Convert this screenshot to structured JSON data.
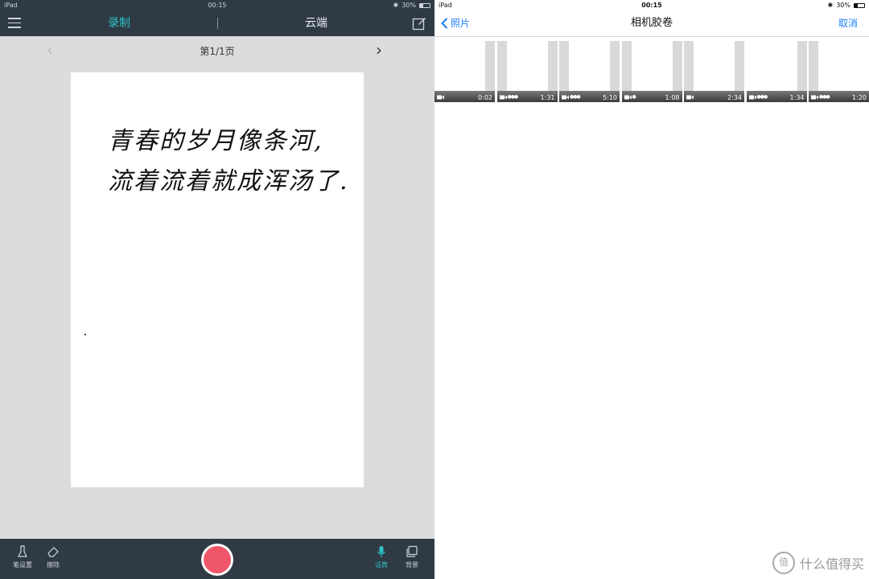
{
  "left": {
    "status": {
      "device": "iPad",
      "time": "00:15",
      "battery": "30%"
    },
    "tabs": {
      "record": "录制",
      "cloud": "云端"
    },
    "pager": {
      "label": "第1/1页"
    },
    "canvas": {
      "line1": "青春的岁月像条河,",
      "line2": "流着流着就成浑汤了."
    },
    "toolbar": {
      "pen": "笔设置",
      "eraser": "擦除",
      "mic": "话筒",
      "background": "背景"
    }
  },
  "right": {
    "status": {
      "device": "iPad",
      "time": "00:15",
      "battery": "30%"
    },
    "nav": {
      "back": "照片",
      "title": "相机胶卷",
      "cancel": "取消"
    },
    "videos": [
      {
        "duration": "0:02"
      },
      {
        "duration": "1:31"
      },
      {
        "duration": "5:10"
      },
      {
        "duration": "1:08"
      },
      {
        "duration": "2:34"
      },
      {
        "duration": "1:34"
      },
      {
        "duration": "1:20"
      }
    ]
  },
  "watermark": {
    "text": "什么值得买",
    "icon": "值"
  },
  "colors": {
    "accent": "#2ec1c7",
    "ios_blue": "#1a7ff5",
    "record_red": "#f0566a",
    "dark_bar": "#2f3a45"
  }
}
